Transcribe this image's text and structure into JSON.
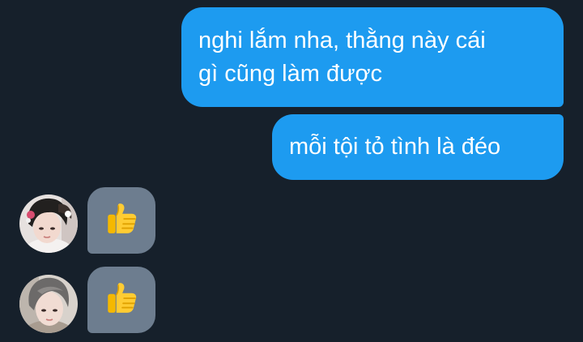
{
  "conversation": {
    "outgoing": [
      {
        "lines": [
          "nghi lắm nha, thằng này cái",
          "gì cũng làm được"
        ]
      },
      {
        "lines": [
          "mỗi tội tỏ tình là đéo"
        ]
      }
    ],
    "incoming": [
      {
        "reaction": "thumbs-up",
        "avatar": "user-avatar-photo"
      },
      {
        "reaction": "thumbs-up",
        "avatar": "user-avatar-photo"
      }
    ]
  },
  "colors": {
    "background": "#16202b",
    "outgoing_bubble": "#1d9bf0",
    "incoming_bubble": "#6d7d8f",
    "text": "#ffffff"
  }
}
